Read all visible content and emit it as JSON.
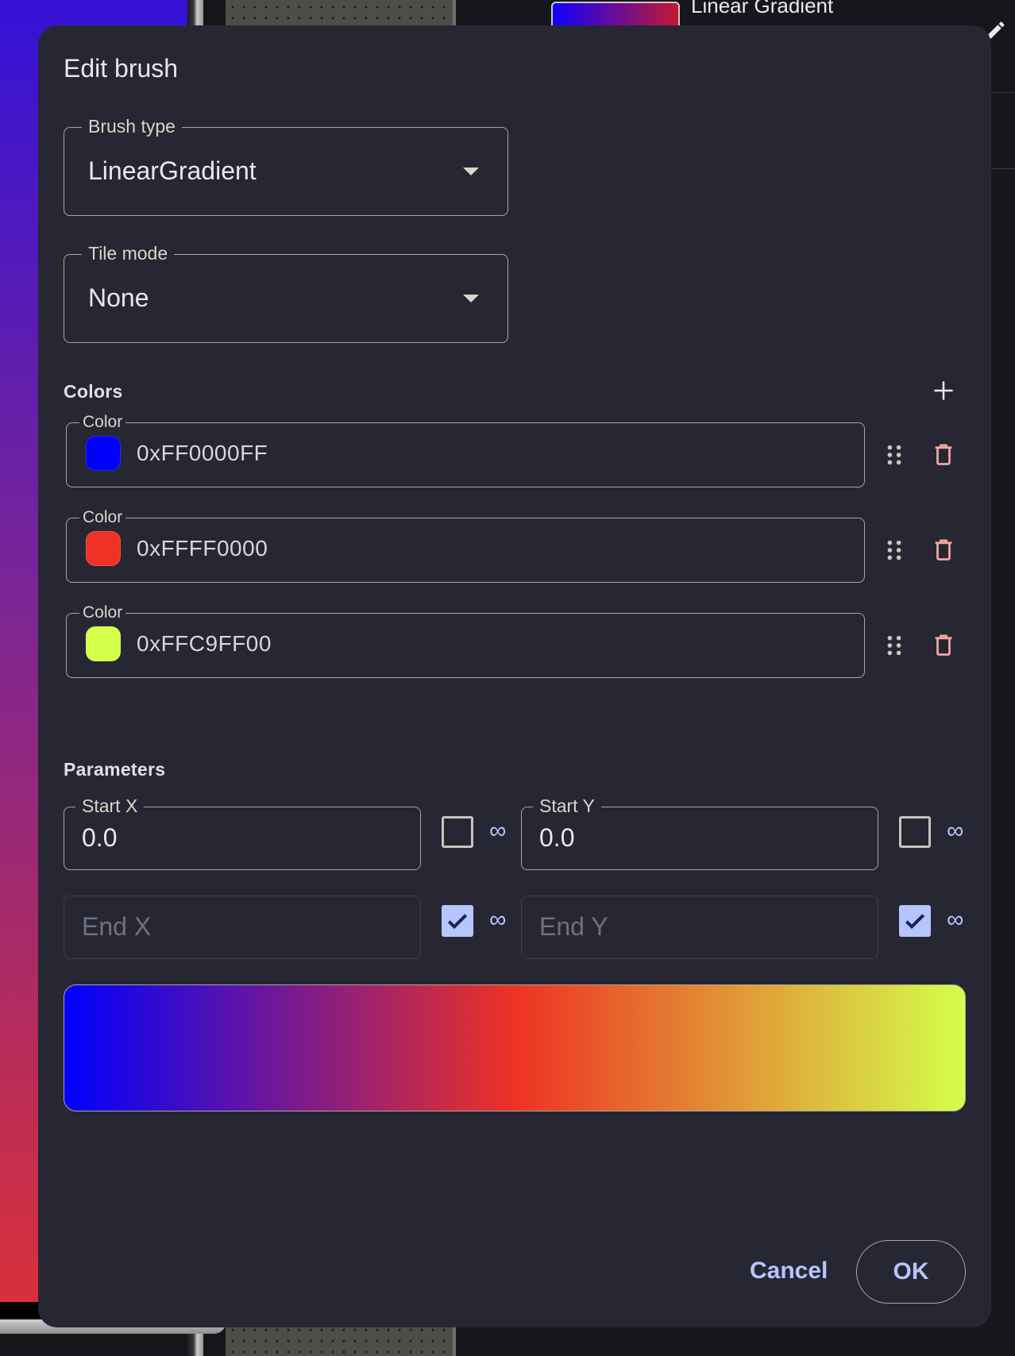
{
  "background": {
    "preview_title": "Linear Gradient"
  },
  "dialog": {
    "title": "Edit brush",
    "brush_type": {
      "label": "Brush type",
      "value": "LinearGradient"
    },
    "tile_mode": {
      "label": "Tile mode",
      "value": "None"
    },
    "colors_section": {
      "label": "Colors",
      "items": [
        {
          "label": "Color",
          "value": "0xFF0000FF",
          "swatch": "#0000ff"
        },
        {
          "label": "Color",
          "value": "0xFFFF0000",
          "swatch": "#ee3224"
        },
        {
          "label": "Color",
          "value": "0xFFC9FF00",
          "swatch": "#d4ff4a"
        }
      ]
    },
    "parameters_section": {
      "label": "Parameters",
      "start_x": {
        "label": "Start X",
        "value": "0.0",
        "infinite": false
      },
      "start_y": {
        "label": "Start Y",
        "value": "0.0",
        "infinite": false
      },
      "end_x": {
        "placeholder": "End X",
        "infinite": true
      },
      "end_y": {
        "placeholder": "End Y",
        "infinite": true
      },
      "infinity_symbol": "∞"
    },
    "preview_colors": [
      "#0000ff",
      "#ee3224",
      "#d4ff4a"
    ],
    "cancel_label": "Cancel",
    "ok_label": "OK"
  },
  "colors": {
    "accent": "#b7c5ff",
    "dialog_bg": "#262733",
    "delete_icon": "#f2a7a0"
  }
}
